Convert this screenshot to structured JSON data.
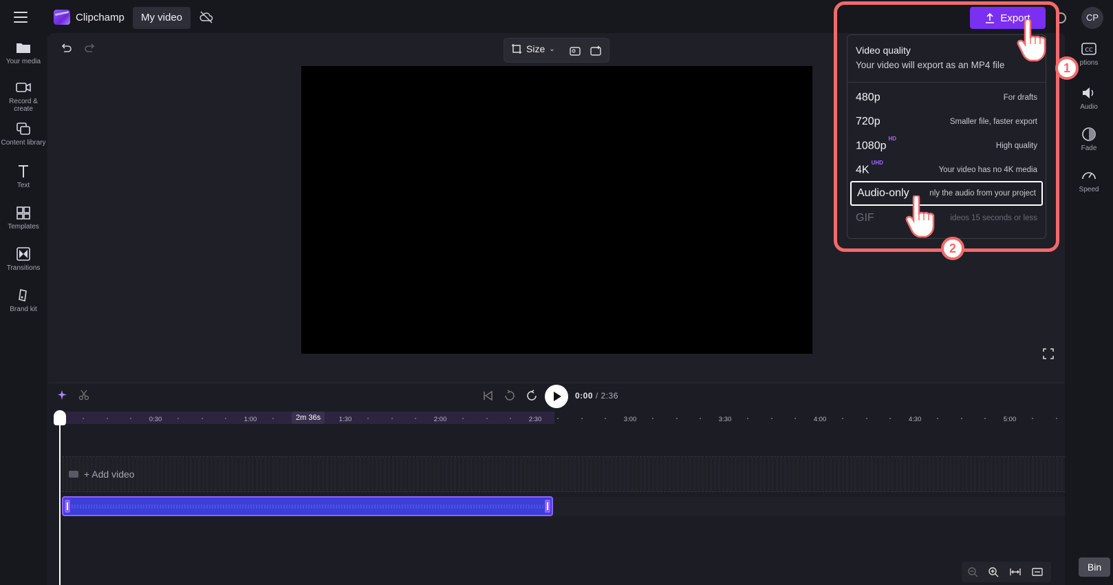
{
  "app": {
    "name": "Clipchamp",
    "project_title": "My video",
    "avatar_initials": "CP"
  },
  "left_nav": [
    {
      "label": "Your media",
      "icon": "folder-icon"
    },
    {
      "label": "Record & create",
      "icon": "camera-icon"
    },
    {
      "label": "Content library",
      "icon": "library-icon"
    },
    {
      "label": "Text",
      "icon": "text-icon"
    },
    {
      "label": "Templates",
      "icon": "templates-icon"
    },
    {
      "label": "Transitions",
      "icon": "transitions-icon"
    },
    {
      "label": "Brand kit",
      "icon": "brand-kit-icon"
    }
  ],
  "right_nav": [
    {
      "label": "ptions",
      "icon": "captions-icon"
    },
    {
      "label": "Audio",
      "icon": "speaker-icon"
    },
    {
      "label": "Fade",
      "icon": "fade-icon"
    },
    {
      "label": "Speed",
      "icon": "speedometer-icon"
    }
  ],
  "toolbar": {
    "size_label": "Size"
  },
  "export": {
    "button_label": "Export",
    "menu_title": "Video quality",
    "menu_subtitle": "Your video will export as an MP4 file",
    "options": [
      {
        "name": "480p",
        "badge": "",
        "desc": "For drafts",
        "state": "normal"
      },
      {
        "name": "720p",
        "badge": "",
        "desc": "Smaller file, faster export",
        "state": "normal"
      },
      {
        "name": "1080p",
        "badge": "HD",
        "desc": "High quality",
        "state": "normal"
      },
      {
        "name": "4K",
        "badge": "UHD",
        "desc": "Your video has no 4K media",
        "state": "normal"
      },
      {
        "name": "Audio-only",
        "badge": "",
        "desc": "nly the audio from your project",
        "state": "selected"
      },
      {
        "name": "GIF",
        "badge": "",
        "desc": "ideos 15 seconds or less",
        "state": "disabled"
      }
    ]
  },
  "callouts": {
    "step1": "1",
    "step2": "2"
  },
  "timeline": {
    "current_time": "0:00",
    "total_time": "/ 2:36",
    "duration_badge": "2m 36s",
    "ticks": [
      "0:30",
      "1:00",
      "1:30",
      "2:00",
      "2:30",
      "3:00",
      "3:30",
      "4:00",
      "4:30",
      "5:00"
    ],
    "add_video_label": "+ Add video",
    "bin_label": "Bin"
  },
  "colors": {
    "accent": "#7b2ff2",
    "highlight": "#f26a6a",
    "clip": "#3b3fd6"
  }
}
